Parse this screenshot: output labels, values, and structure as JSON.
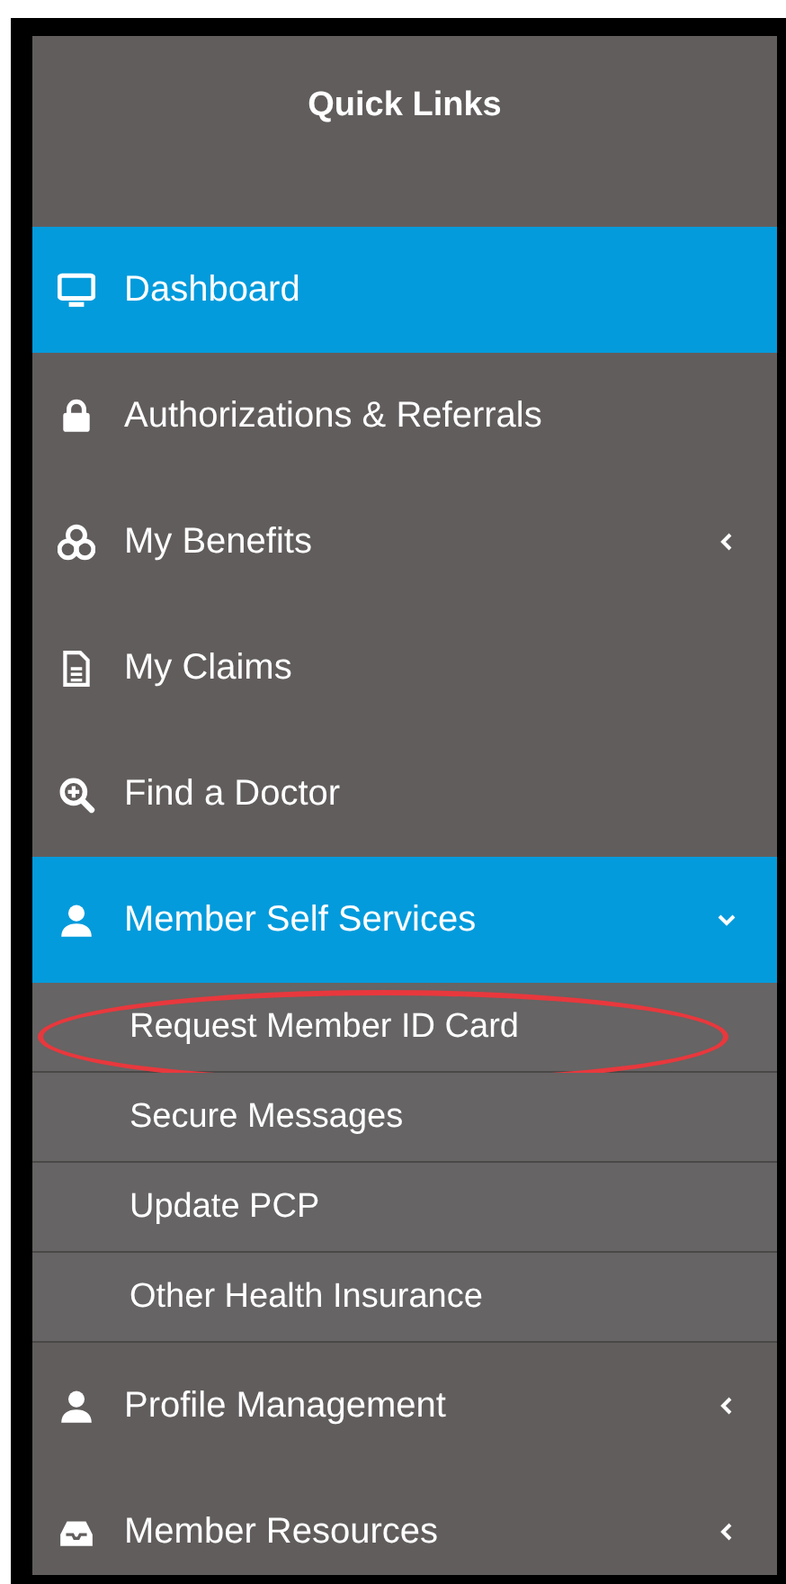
{
  "title": "Quick Links",
  "items": [
    {
      "label": "Dashboard",
      "selected": true
    },
    {
      "label": "Authorizations & Referrals",
      "selected": false
    },
    {
      "label": "My Benefits",
      "selected": false,
      "expanded": false
    },
    {
      "label": "My Claims",
      "selected": false
    },
    {
      "label": "Find a Doctor",
      "selected": false
    },
    {
      "label": "Member Self Services",
      "selected": true,
      "expanded": true,
      "children": [
        {
          "label": "Request Member ID Card",
          "highlighted": true
        },
        {
          "label": "Secure Messages",
          "highlighted": false
        },
        {
          "label": "Update PCP",
          "highlighted": false
        },
        {
          "label": "Other Health Insurance",
          "highlighted": false
        }
      ]
    },
    {
      "label": "Profile Management",
      "selected": false,
      "expanded": false
    },
    {
      "label": "Member Resources",
      "selected": false,
      "expanded": false
    }
  ]
}
